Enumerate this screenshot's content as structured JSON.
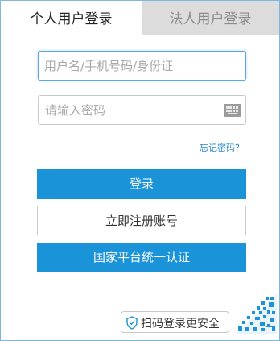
{
  "tabs": {
    "personal": "个人用户登录",
    "corporate": "法人用户登录"
  },
  "form": {
    "username_placeholder": "用户名/手机号码/身份证",
    "password_placeholder": "请输入密码",
    "forgot_password": "忘记密码？"
  },
  "buttons": {
    "login": "登录",
    "register": "立即注册账号",
    "national_auth": "国家平台统一认证"
  },
  "scan": {
    "tip": "扫码登录更安全"
  },
  "colors": {
    "primary": "#1b93d9",
    "link": "#2a88c8",
    "inactive_tab": "#dcdcdc"
  }
}
